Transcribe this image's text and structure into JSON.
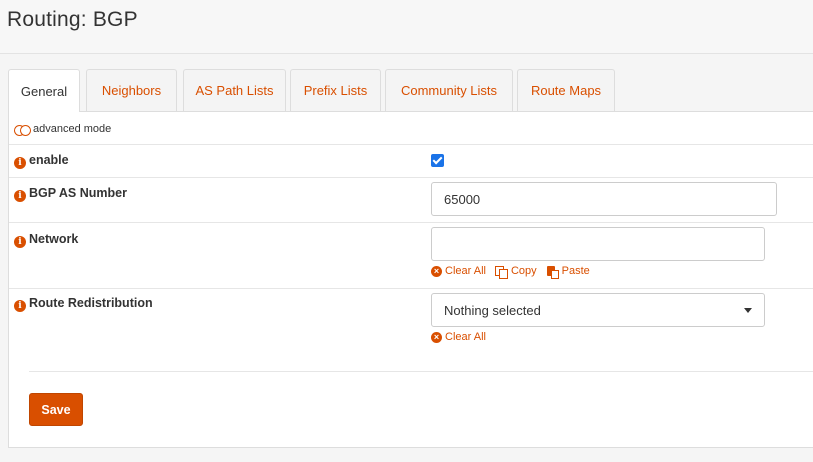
{
  "page": {
    "title": "Routing: BGP"
  },
  "tabs": [
    {
      "label": "General",
      "active": true
    },
    {
      "label": "Neighbors"
    },
    {
      "label": "AS Path Lists"
    },
    {
      "label": "Prefix Lists"
    },
    {
      "label": "Community Lists"
    },
    {
      "label": "Route Maps"
    }
  ],
  "form": {
    "advanced_mode_label": "advanced mode",
    "enable": {
      "label": "enable",
      "checked": true
    },
    "as_number": {
      "label": "BGP AS Number",
      "value": "65000"
    },
    "network": {
      "label": "Network",
      "value": ""
    },
    "route_redistribution": {
      "label": "Route Redistribution",
      "selected": "Nothing selected"
    },
    "tokens": {
      "clear_all": "Clear All",
      "copy": "Copy",
      "paste": "Paste"
    },
    "save_label": "Save"
  },
  "colors": {
    "accent": "#d94f00",
    "checkbox": "#1a73e8"
  },
  "icons": [
    "info-icon",
    "toggle-off-icon",
    "clear-icon",
    "copy-icon",
    "paste-icon",
    "caret-down-icon",
    "checkmark-icon"
  ]
}
